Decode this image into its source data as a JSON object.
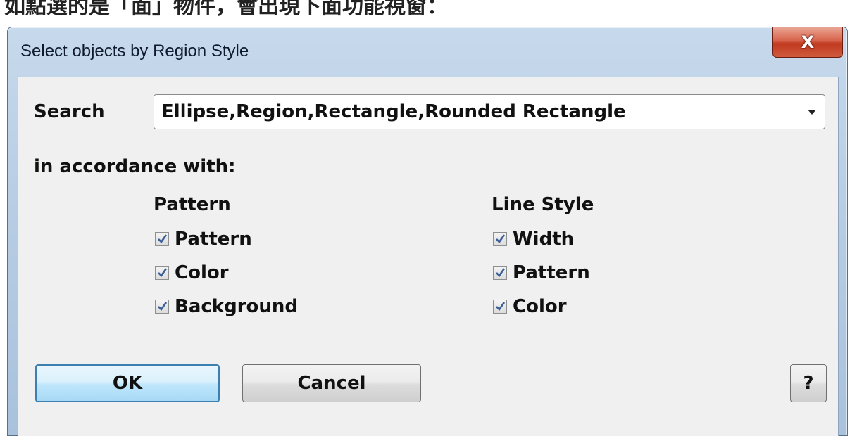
{
  "caption": "如點選的是「面」物件，會出現下面功能視窗：",
  "dialog": {
    "title": "Select objects by Region Style",
    "close_label": "X"
  },
  "search": {
    "label": "Search",
    "value": "Ellipse,Region,Rectangle,Rounded Rectangle"
  },
  "accordance_label": "in accordance with:",
  "pattern_group": {
    "heading": "Pattern",
    "options": [
      {
        "label": "Pattern",
        "checked": true
      },
      {
        "label": "Color",
        "checked": true
      },
      {
        "label": "Background",
        "checked": true
      }
    ]
  },
  "line_style_group": {
    "heading": "Line Style",
    "options": [
      {
        "label": "Width",
        "checked": true
      },
      {
        "label": "Pattern",
        "checked": true
      },
      {
        "label": "Color",
        "checked": true
      }
    ]
  },
  "buttons": {
    "ok": "OK",
    "cancel": "Cancel",
    "help": "?"
  },
  "colors": {
    "title_bar": "#b6cde4",
    "client_bg": "#f0f0f0",
    "close_button": "#c0391f",
    "default_button_border": "#3c7fb1",
    "checkmark": "#3a5f96"
  }
}
